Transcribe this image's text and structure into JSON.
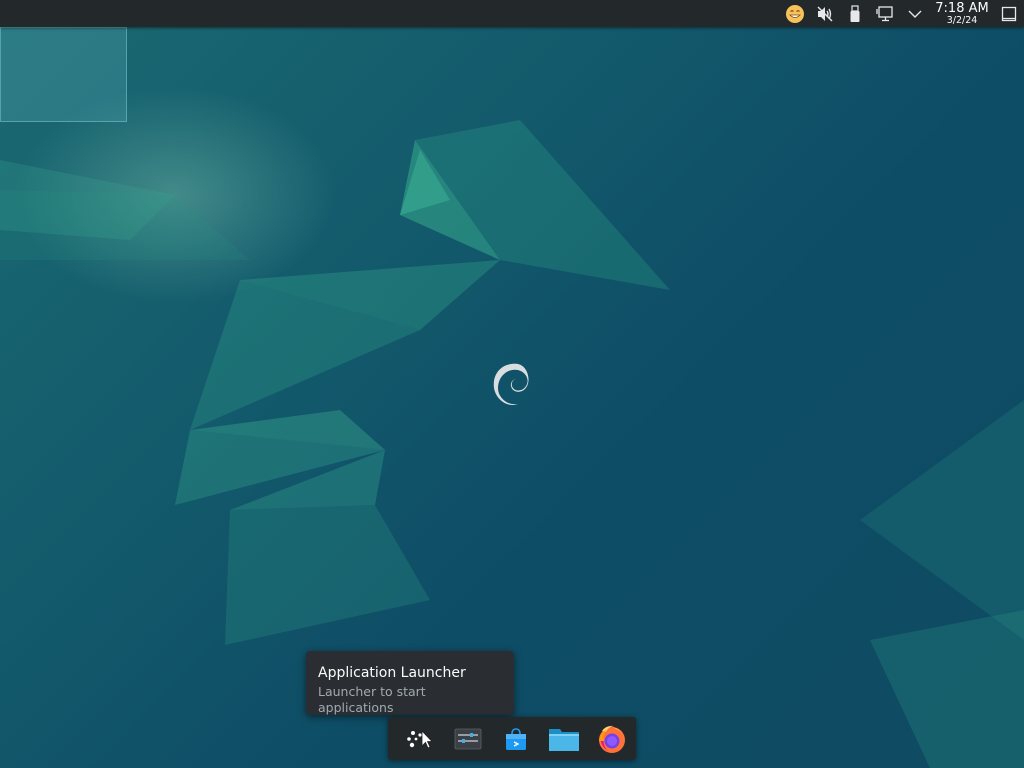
{
  "top_panel": {
    "clock": {
      "time": "7:18 AM",
      "date": "3/2/24"
    },
    "tray_icons": [
      "emoji-selector-icon",
      "volume-muted-icon",
      "usb-device-icon",
      "network-wired-icon",
      "expand-tray-chevron-icon"
    ],
    "show_desktop_icon": "show-desktop-icon"
  },
  "pager": {
    "desktops": 1,
    "active": 1
  },
  "tooltip": {
    "title": "Application Launcher",
    "subtitle": "Launcher to start applications"
  },
  "bottom_panel": {
    "launchers": [
      {
        "name": "application-launcher",
        "icon": "debian-kickoff-icon"
      },
      {
        "name": "system-settings",
        "icon": "settings-sliders-icon"
      },
      {
        "name": "discover-software-center",
        "icon": "shopping-bag-icon"
      },
      {
        "name": "dolphin-file-manager",
        "icon": "folder-icon"
      },
      {
        "name": "firefox-browser",
        "icon": "firefox-icon"
      }
    ]
  },
  "colors": {
    "panel": "#23282b",
    "tooltip_bg": "#2a2e32",
    "wallpaper_dark": "#0f4c63",
    "wallpaper_light": "#1f8a7a"
  }
}
